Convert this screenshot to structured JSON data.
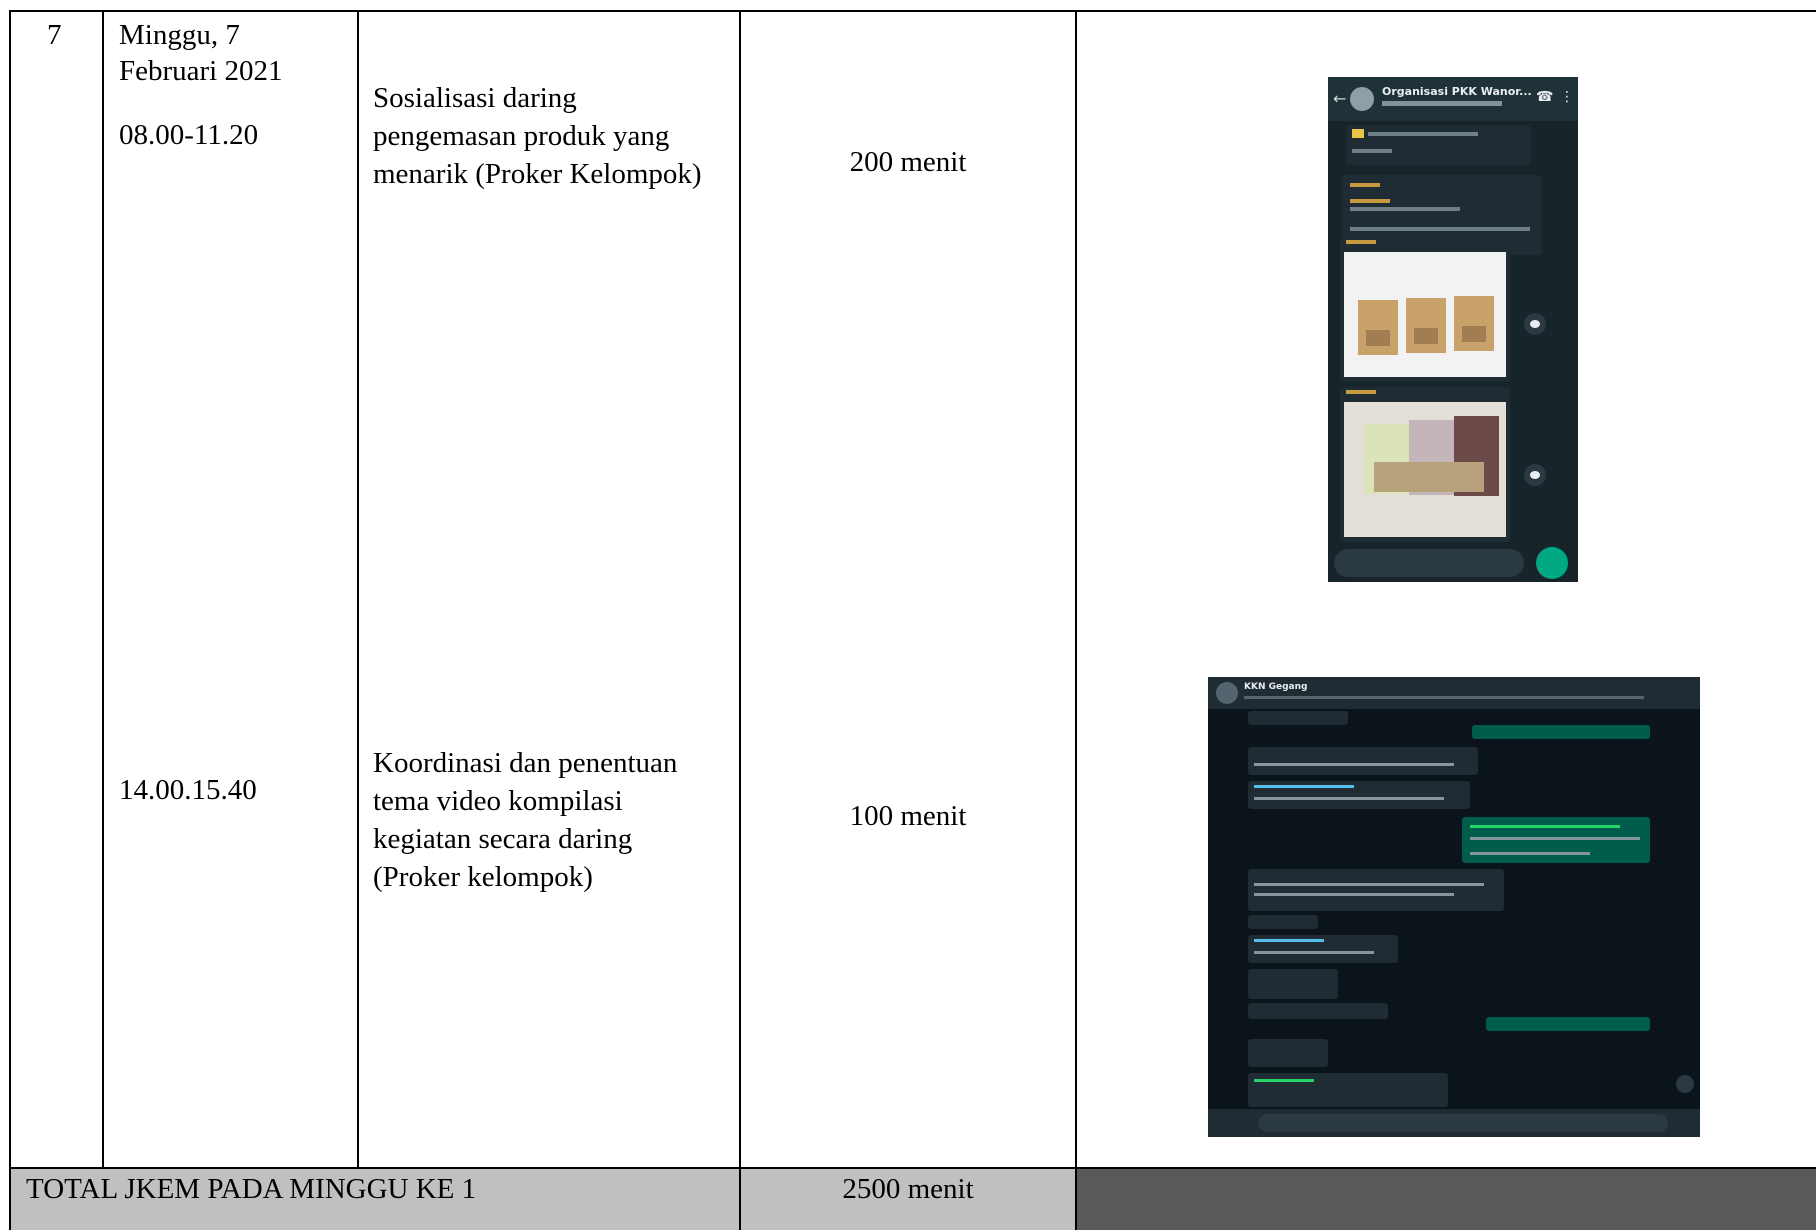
{
  "row": {
    "number": "7",
    "date_line1": "Minggu, 7",
    "date_line2": "Februari 2021",
    "sessions": [
      {
        "time": "08.00-11.20",
        "activity_lines": [
          "Sosialisasi daring",
          "pengemasan produk yang",
          "menarik (Proker Kelompok)"
        ],
        "duration": "200 menit",
        "evidence": {
          "chat_title": "Organisasi PKK Wanor..."
        }
      },
      {
        "time": "14.00.15.40",
        "activity_lines": [
          "Koordinasi dan penentuan",
          "tema video kompilasi",
          "kegiatan secara daring",
          "(Proker kelompok)"
        ],
        "duration": "100 menit",
        "evidence": {
          "chat_title": "KKN Gegang"
        }
      }
    ]
  },
  "total": {
    "label": "TOTAL JKEM PADA MINGGU KE 1",
    "value": "2500 menit"
  },
  "colors": {
    "total_row_bg": "#c0c0c0",
    "total_last_cell_bg": "#595959"
  }
}
